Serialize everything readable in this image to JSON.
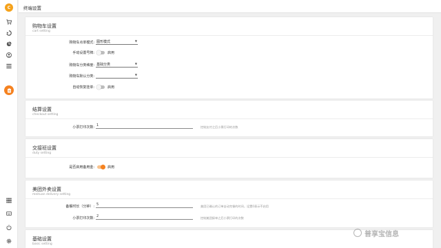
{
  "app": {
    "logo_letter": "C",
    "page_title": "终端设置",
    "accent_color": "#f58220"
  },
  "sidebar": {
    "top_icons": [
      "cart-icon",
      "rotate-icon",
      "pie-chart-icon",
      "user-icon",
      "list-icon",
      "clipboard-icon"
    ],
    "active": "clipboard-icon",
    "bottom_icons": [
      "grid-icon",
      "keyboard-icon",
      "power-icon",
      "settings-icon"
    ]
  },
  "sections": {
    "cart": {
      "title": "购物车设置",
      "subtitle": "cart setting",
      "mode_label": "购物车点单模式:",
      "mode_value": "图形模式",
      "manual_label": "手动设置号牌:",
      "manual_toggle_text": "启用",
      "manual_enabled": false,
      "category_label": "购物车分类维度:",
      "category_value": "基础分类",
      "default_label": "购物车默认分类:",
      "default_value": "",
      "auto_restore_label": "自动恢复挂单:",
      "auto_restore_toggle_text": "启用",
      "auto_restore_enabled": false
    },
    "checkout": {
      "title": "结算设置",
      "subtitle": "checkout setting",
      "print_label": "小票打印次数:",
      "print_value": "1",
      "print_hint": "控制支付之后小票打印的次数"
    },
    "duty": {
      "title": "交接班设置",
      "subtitle": "duty setting",
      "reserve_label": "是否启用备用金:",
      "reserve_toggle_text": "启用",
      "reserve_enabled": true
    },
    "meituan": {
      "title": "美团外卖设置",
      "subtitle": "meituan delivery setting",
      "prep_label": "备餐时长（分钟）:",
      "prep_value": "5",
      "prep_hint": "美团已确认的订单自动完餐的时间，设置0表示不启用",
      "print_label": "小票打印次数:",
      "print_value": "2",
      "print_hint": "控制美团接单之后小票打印的次数"
    },
    "basic": {
      "title": "基础设置",
      "subtitle": "basic setting"
    }
  },
  "watermark": {
    "text": "普享宝信息"
  }
}
